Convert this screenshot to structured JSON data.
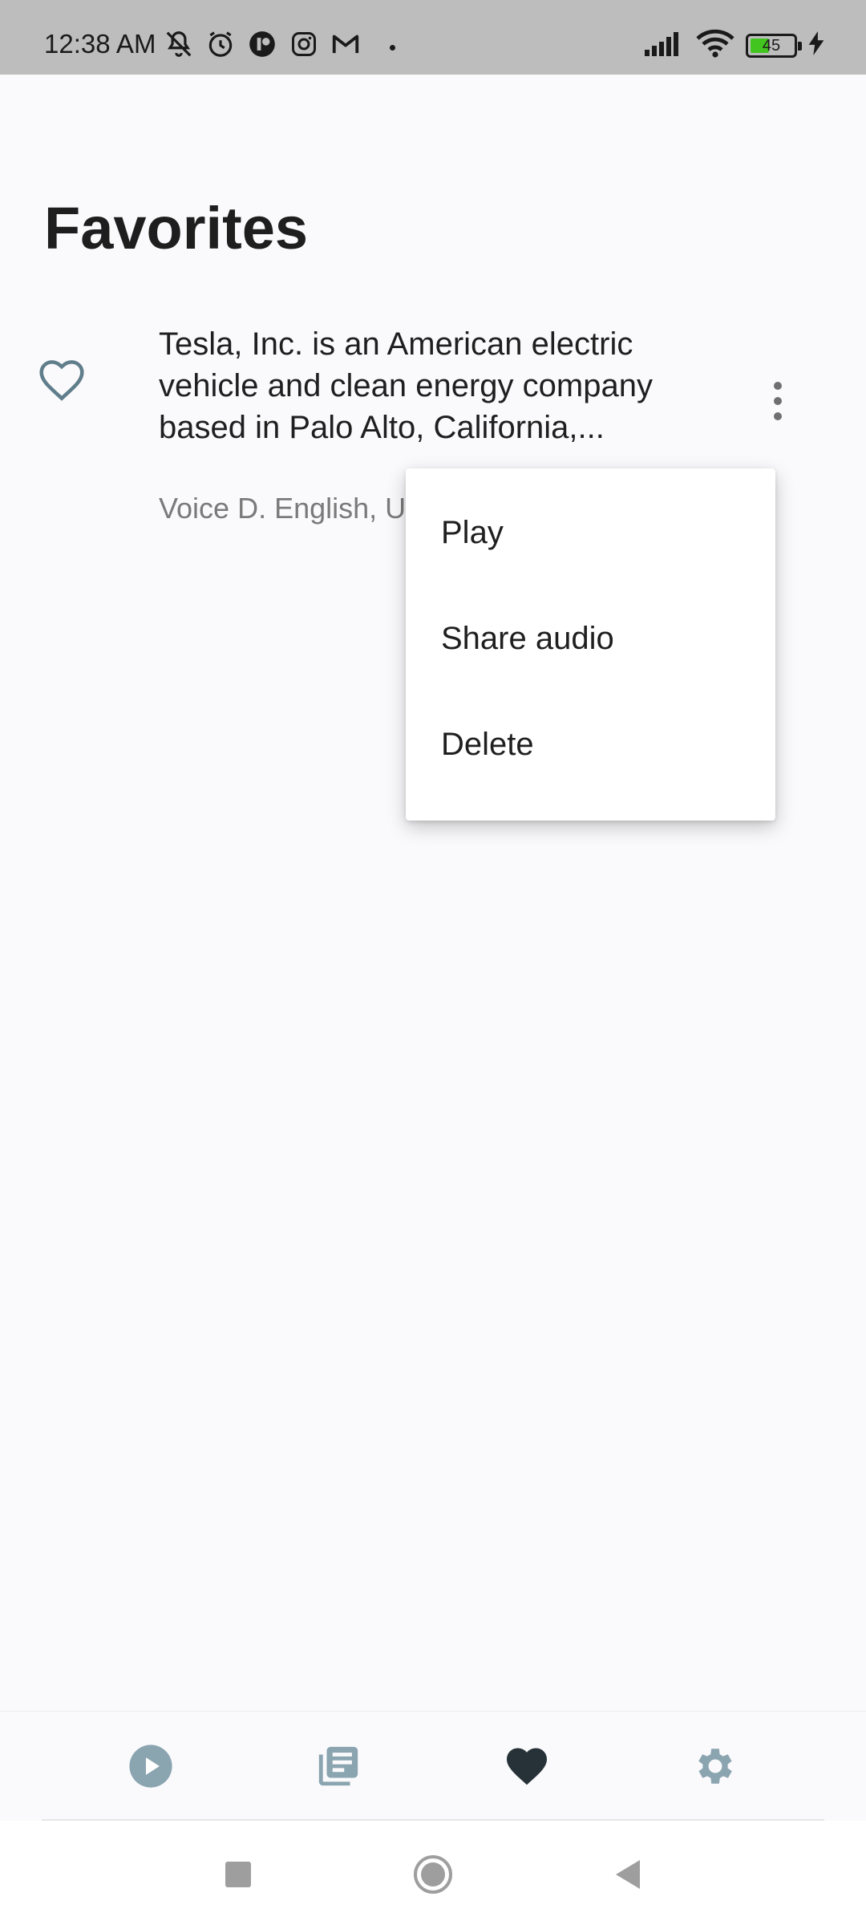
{
  "status_bar": {
    "time": "12:38 AM",
    "battery_level": "45",
    "battery_fraction": 0.45,
    "icons_left": [
      "mute-icon",
      "alarm-icon",
      "app-icon",
      "instagram-icon",
      "gmail-icon"
    ],
    "icons_right": [
      "signal-icon",
      "wifi-icon",
      "battery-icon",
      "charging-icon"
    ]
  },
  "page": {
    "title": "Favorites"
  },
  "favorites": [
    {
      "text": "Tesla, Inc. is an American electric vehicle and clean energy company based in Palo Alto, California,...",
      "subtitle": "Voice D. English, U",
      "favorited": true
    }
  ],
  "popup_menu": {
    "items": [
      "Play",
      "Share audio",
      "Delete"
    ]
  },
  "bottom_nav": {
    "items": [
      {
        "icon": "play-circle-icon",
        "color": "#8aa4b0",
        "active": false
      },
      {
        "icon": "library-icon",
        "color": "#8aa4b0",
        "active": false
      },
      {
        "icon": "heart-icon",
        "color": "#263238",
        "active": true
      },
      {
        "icon": "settings-icon",
        "color": "#8aa4b0",
        "active": false
      }
    ]
  },
  "colors": {
    "accent_dark": "#263238",
    "inactive_icon": "#8aa4b0",
    "fav_icon_outline": "#607d8b"
  }
}
